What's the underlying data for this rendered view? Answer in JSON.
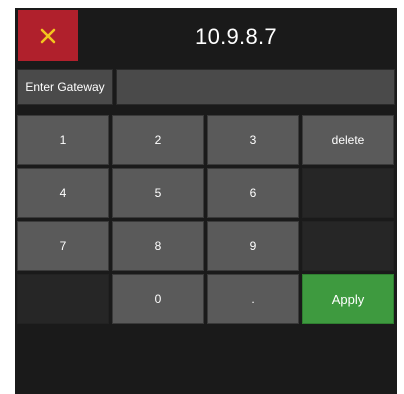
{
  "header": {
    "close_icon": "x-icon",
    "title": "10.9.8.7"
  },
  "gateway": {
    "label": "Enter Gateway",
    "value": ""
  },
  "keypad": {
    "k1": "1",
    "k2": "2",
    "k3": "3",
    "delete": "delete",
    "k4": "4",
    "k5": "5",
    "k6": "6",
    "k7": "7",
    "k8": "8",
    "k9": "9",
    "k0": "0",
    "dot": ".",
    "apply": "Apply"
  },
  "colors": {
    "close_bg": "#b0202c",
    "close_icon": "#f3c61f",
    "panel_bg": "#1a1a1a",
    "key_bg": "#5a5a5a",
    "apply_bg": "#3e9a3f"
  }
}
